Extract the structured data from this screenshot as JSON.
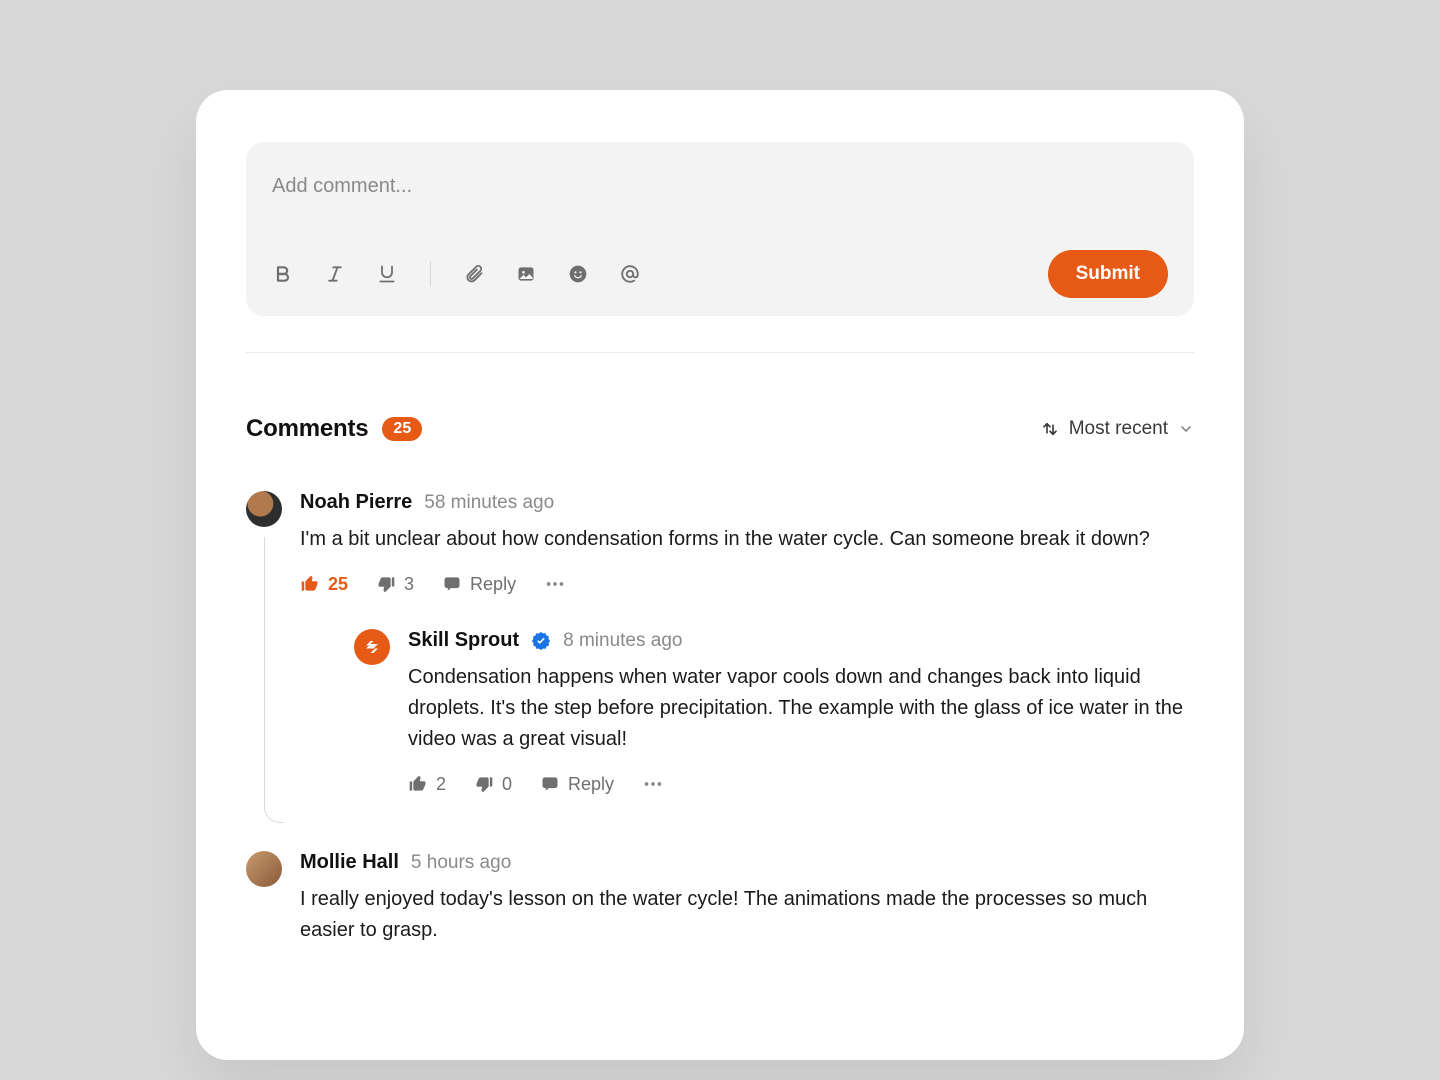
{
  "composer": {
    "placeholder": "Add comment...",
    "submit_label": "Submit"
  },
  "header": {
    "title": "Comments",
    "count": "25",
    "sort_label": "Most recent"
  },
  "icons": {
    "bold": "bold-icon",
    "italic": "italic-icon",
    "underline": "underline-icon",
    "attach": "paperclip-icon",
    "image": "image-icon",
    "emoji": "emoji-icon",
    "mention": "at-sign-icon",
    "sort_arrows": "sort-arrows-icon",
    "chevron": "chevron-down-icon",
    "thumb_up": "thumb-up-icon",
    "thumb_down": "thumb-down-icon",
    "reply": "reply-icon",
    "more": "more-icon",
    "verified": "verified-badge-icon"
  },
  "comments": [
    {
      "author": "Noah Pierre",
      "time": "58 minutes ago",
      "text": "I'm a bit unclear about how condensation forms in the water cycle. Can someone break it down?",
      "up": "25",
      "down": "3",
      "reply_label": "Reply",
      "up_active": true,
      "verified": false,
      "avatar_kind": "photo-a",
      "replies": [
        {
          "author": "Skill Sprout",
          "time": "8 minutes ago",
          "text": "Condensation happens when water vapor cools down and changes back into liquid droplets. It's the step before precipitation. The example with the glass of ice water in the video was a great visual!",
          "up": "2",
          "down": "0",
          "reply_label": "Reply",
          "up_active": false,
          "verified": true,
          "avatar_kind": "brand"
        }
      ]
    },
    {
      "author": "Mollie Hall",
      "time": "5 hours ago",
      "text": "I really enjoyed today's lesson on the water cycle! The animations made the processes so much easier to grasp.",
      "up": "",
      "down": "",
      "reply_label": "Reply",
      "up_active": false,
      "verified": false,
      "avatar_kind": "photo-b",
      "replies": []
    }
  ]
}
